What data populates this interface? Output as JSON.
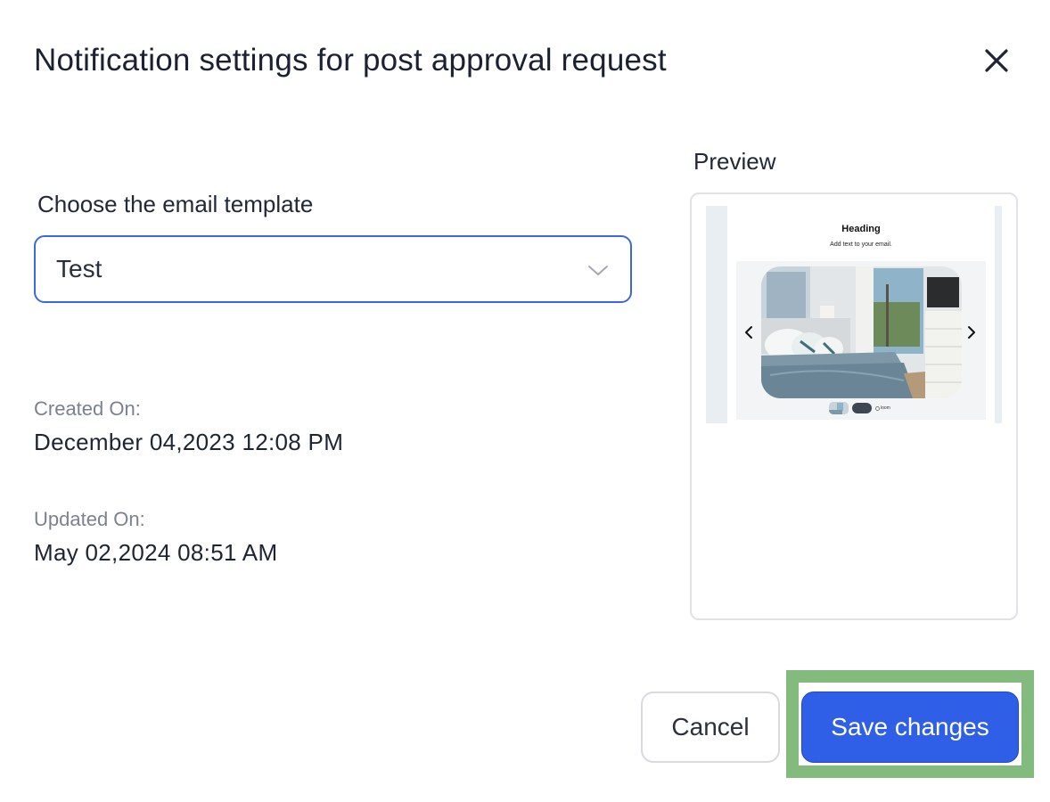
{
  "modal": {
    "title": "Notification settings for post approval request"
  },
  "template_field": {
    "label": "Choose the email template",
    "selected": "Test"
  },
  "meta": {
    "created_label": "Created On:",
    "created_value": "December 04,2023 12:08 PM",
    "updated_label": "Updated On:",
    "updated_value": "May 02,2024 08:51 AM"
  },
  "preview": {
    "label": "Preview",
    "email_heading": "Heading",
    "email_text": "Add text to your email.",
    "brand_tag": "loom"
  },
  "actions": {
    "cancel_label": "Cancel",
    "save_label": "Save changes"
  },
  "colors": {
    "primary": "#2e5fe6",
    "focus_border": "#3d67e0",
    "highlight": "#83bb7f"
  },
  "icons": {
    "close": "close-icon",
    "dropdown": "chevron-down-icon",
    "prev": "chevron-left-icon",
    "next": "chevron-right-icon"
  }
}
